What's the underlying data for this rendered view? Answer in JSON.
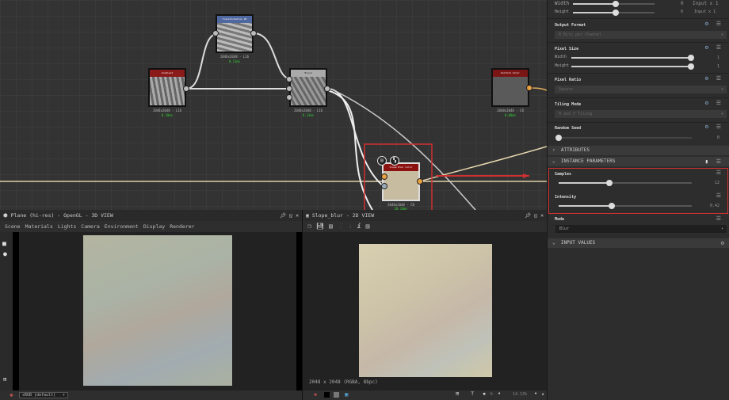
{
  "graph": {
    "nodes": [
      {
        "title": "Gradient",
        "res": "2048x2048 - L16",
        "time": "0.10ms",
        "header": "#8b1a1a"
      },
      {
        "title": "Transformation 2D",
        "res": "2048x2048 - L16",
        "time": "0.13ms",
        "header": "#5068a0"
      },
      {
        "title": "Blend",
        "res": "2048x2048 - L16",
        "time": "0.13ms",
        "header": "#aaaaaa"
      },
      {
        "title": "Uniform Color",
        "res": "2048x2048 - C8",
        "time": "0.00ms",
        "header": "#7a1515"
      },
      {
        "title": "Slope Blur Color",
        "res": "2048x2048 - C8",
        "time": "10.10ms",
        "header": "#8b1010"
      }
    ],
    "highlight_color": "#d03030",
    "connection_color": "#e8d8b0"
  },
  "properties": {
    "top": {
      "width_label": "Width",
      "height_label": "Height",
      "width_value": "0",
      "height_value": "0",
      "width_mode": "Input x 1",
      "height_mode": "Input x 1"
    },
    "output_format": {
      "label": "Output Format",
      "value": "8 Bits per Channel"
    },
    "pixel_size": {
      "label": "Pixel Size",
      "width_label": "Width",
      "height_label": "Height",
      "width_value": "1",
      "height_value": "1"
    },
    "pixel_ratio": {
      "label": "Pixel Ratio",
      "value": "Square"
    },
    "tiling_mode": {
      "label": "Tiling Mode",
      "value": "H and V Tiling"
    },
    "random_seed": {
      "label": "Random Seed",
      "value": "0"
    },
    "attributes": "ATTRIBUTES",
    "instance_parameters": "INSTANCE PARAMETERS",
    "samples": {
      "label": "Samples",
      "value": "12",
      "fraction": 0.38
    },
    "intensity": {
      "label": "Intensity",
      "value": "0.42",
      "fraction": 0.4
    },
    "mode": {
      "label": "Mode",
      "value": "Blur"
    },
    "input_values": "INPUT VALUES"
  },
  "view3d": {
    "title": "Plane (hi-res) - OpenGL - 3D VIEW",
    "menu": [
      "Scene",
      "Materials",
      "Lights",
      "Camera",
      "Environment",
      "Display",
      "Renderer"
    ],
    "colorspace": "sRGB (default)"
  },
  "view2d": {
    "title": "Slope_blur - 2D VIEW",
    "info": "2048 x 2048 (RGBA, 8bpc)",
    "zoom": "14.13%"
  }
}
